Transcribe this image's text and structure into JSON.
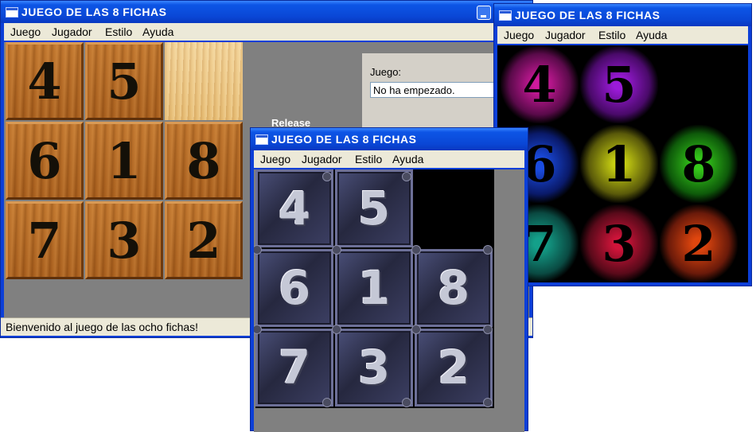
{
  "menu": [
    "Juego",
    "Jugador",
    "Estilo",
    "Ayuda"
  ],
  "win_wood": {
    "title": "JUEGO DE LAS 8 FICHAS",
    "tiles": [
      "4",
      "5",
      "",
      "6",
      "1",
      "8",
      "7",
      "3",
      "2"
    ],
    "panel_label": "Juego:",
    "panel_value": "No ha empezado.",
    "status": "Bienvenido al juego de las ocho fichas!",
    "background_text": "Release"
  },
  "win_metal": {
    "title": "JUEGO DE LAS 8 FICHAS",
    "tiles": [
      "4",
      "5",
      "",
      "6",
      "1",
      "8",
      "7",
      "3",
      "2"
    ]
  },
  "win_neon": {
    "title": "JUEGO DE LAS 8 FICHAS",
    "tiles": [
      "4",
      "5",
      "",
      "6",
      "1",
      "8",
      "7",
      "3",
      "2"
    ],
    "tile_colors": [
      "#d01a9e",
      "#9b1ad8",
      "",
      "#1a4ce0",
      "#c8d012",
      "#35c81a",
      "#14a08a",
      "#d0143a",
      "#e0460e"
    ]
  },
  "colors": {
    "titlebar": "#0a47d6",
    "menubar": "#ece9d8",
    "client": "#808080",
    "neon_bg": "#000000"
  }
}
